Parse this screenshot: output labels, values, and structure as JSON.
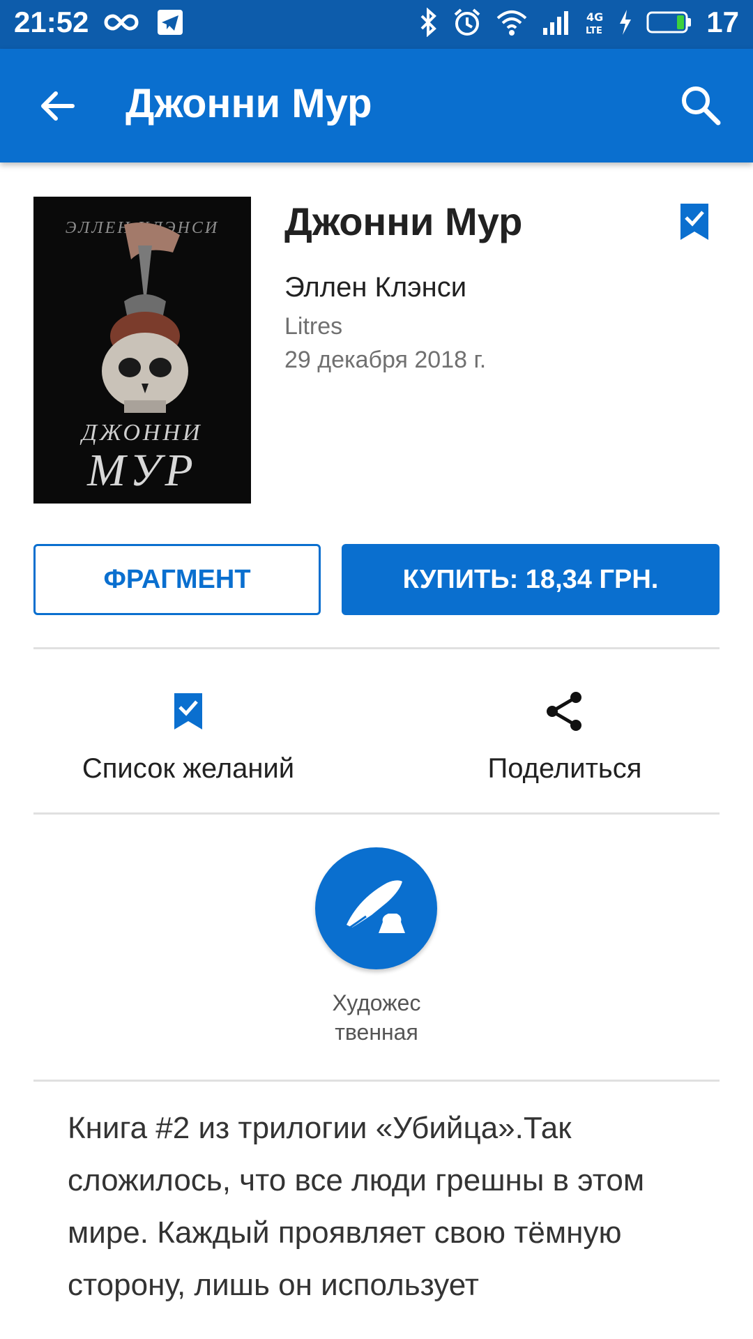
{
  "status_bar": {
    "time": "21:52",
    "battery_level": "17"
  },
  "app_bar": {
    "title": "Джонни Мур"
  },
  "book": {
    "cover": {
      "author": "ЭЛЛЕН КЛЭНСИ",
      "title_line1": "ДЖОННИ",
      "title_line2": "МУР"
    },
    "title": "Джонни Мур",
    "author": "Эллен Клэнси",
    "publisher": "Litres",
    "date": "29 декабря 2018 г."
  },
  "buttons": {
    "fragment": "ФРАГМЕНТ",
    "buy": "КУПИТЬ: 18,34 ГРН."
  },
  "actions": {
    "wishlist": "Список желаний",
    "share": "Поделиться"
  },
  "genre": {
    "line1": "Художес",
    "line2": "твенная"
  },
  "description": "Книга #2 из трилогии «Убийца».Так сложилось, что все люди грешны в этом мире. Каждый проявляет свою тёмную сторону, лишь он использует",
  "colors": {
    "status_bar": "#0d5cab",
    "app_bar": "#0a6fcf",
    "accent": "#0a6fcf"
  }
}
